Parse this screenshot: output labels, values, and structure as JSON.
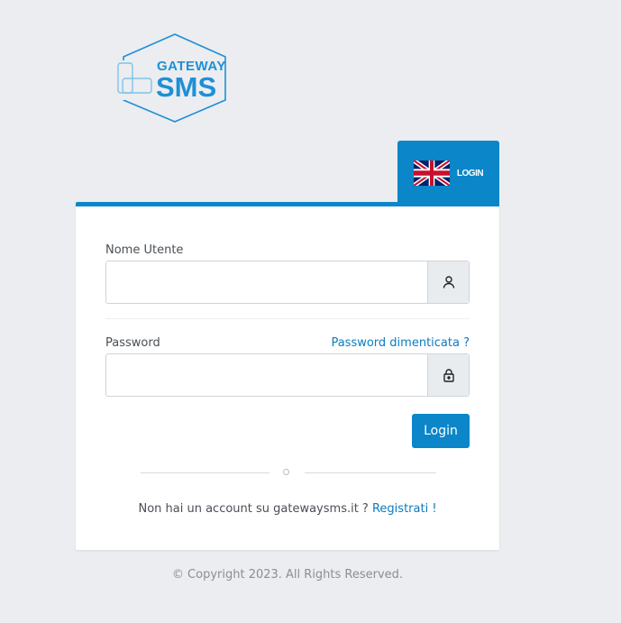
{
  "logo": {
    "text_top": "GATEWAY",
    "text_bottom": "SMS"
  },
  "language": {
    "label": "LOGIN",
    "flag_icon": "uk-flag-icon"
  },
  "form": {
    "username_label": "Nome Utente",
    "username_value": "",
    "username_icon": "user-icon",
    "password_label": "Password",
    "password_value": "",
    "password_icon": "lock-icon",
    "forgot_link": "Password dimenticata ?",
    "submit_label": "Login"
  },
  "signup": {
    "text": "Non hai un account su gatewaysms.it ?",
    "link": "Registrati !"
  },
  "footer": {
    "copyright": "© Copyright 2023. All Rights Reserved."
  },
  "colors": {
    "primary": "#0b86c9",
    "background": "#ebedf0",
    "link": "#0b7cc1"
  }
}
